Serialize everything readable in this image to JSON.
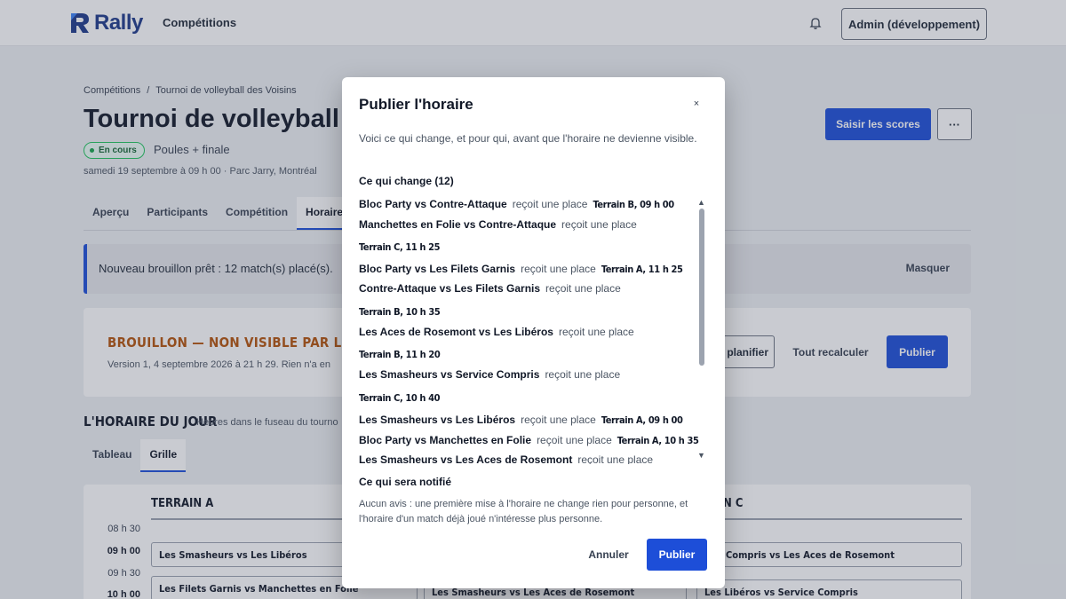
{
  "header": {
    "logo_text": "Rally",
    "nav_competitions": "Compétitions",
    "admin_button": "Admin (développement)",
    "logo_icon": "rally-logo-icon",
    "bell_icon": "bell-icon",
    "brand_color": "#1e3a8a"
  },
  "page": {
    "breadcrumb": [
      "Compétitions",
      "/",
      "Tournoi de volleyball des Voisins"
    ],
    "title": "Tournoi de volleyball de",
    "status_badge": "En cours",
    "format": "Poules + finale",
    "meta": "samedi 19 septembre à 09 h 00  ·  Parc Jarry, Montréal",
    "scores_button": "Saisir les scores",
    "more_button": "···",
    "tabs": [
      "Aperçu",
      "Participants",
      "Compétition",
      "Horaire"
    ],
    "alert_text": "Nouveau brouillon prêt : 12 match(s) placé(s).",
    "alert_hide": "Masquer",
    "draft_title": "BROUILLON — NON VISIBLE PAR LES PARTIC",
    "draft_sub": "Version 1, 4 septembre 2026 à 21 h 29. Rien n'a en",
    "replan_button": "planifier",
    "recalc_button": "Tout recalculer",
    "publish_button": "Publier",
    "day_title": "L'HORAIRE DU JOUR",
    "day_sub": "Heures dans le fuseau du tourno",
    "view_tabs": [
      "Tableau",
      "Grille"
    ],
    "accent_color": "#1d4ed8",
    "draft_color": "#b45309"
  },
  "grid": {
    "courts": [
      "TERRAIN A",
      "N C"
    ],
    "times": [
      "08 h 30",
      "09 h 00",
      "09 h 30",
      "10 h 00"
    ],
    "matches": [
      "Les Smasheurs vs Les Libéros",
      "Les Filets Garnis vs Manchettes en Folie",
      "Les Smasheurs vs Les Aces de Rosemont",
      "ce Compris vs Les Aces de Rosemont",
      "Les Libéros vs Service Compris"
    ]
  },
  "modal": {
    "title": "Publier l'horaire",
    "close_icon": "close-icon",
    "close_label": "×",
    "intro": "Voici ce qui change, et pour qui, avant que l'horaire ne devienne visible.",
    "changes_title": "Ce qui change (12)",
    "changes": [
      {
        "match": "Bloc Party vs Contre-Attaque",
        "action": "reçoit une place",
        "slot": "Terrain B, 09 h 00"
      },
      {
        "match": "Manchettes en Folie vs Contre-Attaque",
        "action": "reçoit une place",
        "slot": "Terrain C, 11 h 25"
      },
      {
        "match": "Bloc Party vs Les Filets Garnis",
        "action": "reçoit une place",
        "slot": "Terrain A, 11 h 25"
      },
      {
        "match": "Contre-Attaque vs Les Filets Garnis",
        "action": "reçoit une place",
        "slot": "Terrain B, 10 h 35"
      },
      {
        "match": "Les Aces de Rosemont vs Les Libéros",
        "action": "reçoit une place",
        "slot": "Terrain B, 11 h 20"
      },
      {
        "match": "Les Smasheurs vs Service Compris",
        "action": "reçoit une place",
        "slot": "Terrain C, 10 h 40"
      },
      {
        "match": "Les Smasheurs vs Les Libéros",
        "action": "reçoit une place",
        "slot": "Terrain A, 09 h 00"
      },
      {
        "match": "Bloc Party vs Manchettes en Folie",
        "action": "reçoit une place",
        "slot": "Terrain A, 10 h 35"
      },
      {
        "match": "Les Smasheurs vs Les Aces de Rosemont",
        "action": "reçoit une place",
        "slot": ""
      }
    ],
    "scroll_up_icon": "scroll-up-arrow-icon",
    "scroll_down_icon": "scroll-down-arrow-icon",
    "notify_title": "Ce qui sera notifié",
    "notify_text": "Aucun avis : une première mise à l'horaire ne change rien pour personne, et l'horaire d'un match déjà joué n'intéresse plus personne.",
    "cancel_button": "Annuler",
    "publish_button": "Publier"
  }
}
